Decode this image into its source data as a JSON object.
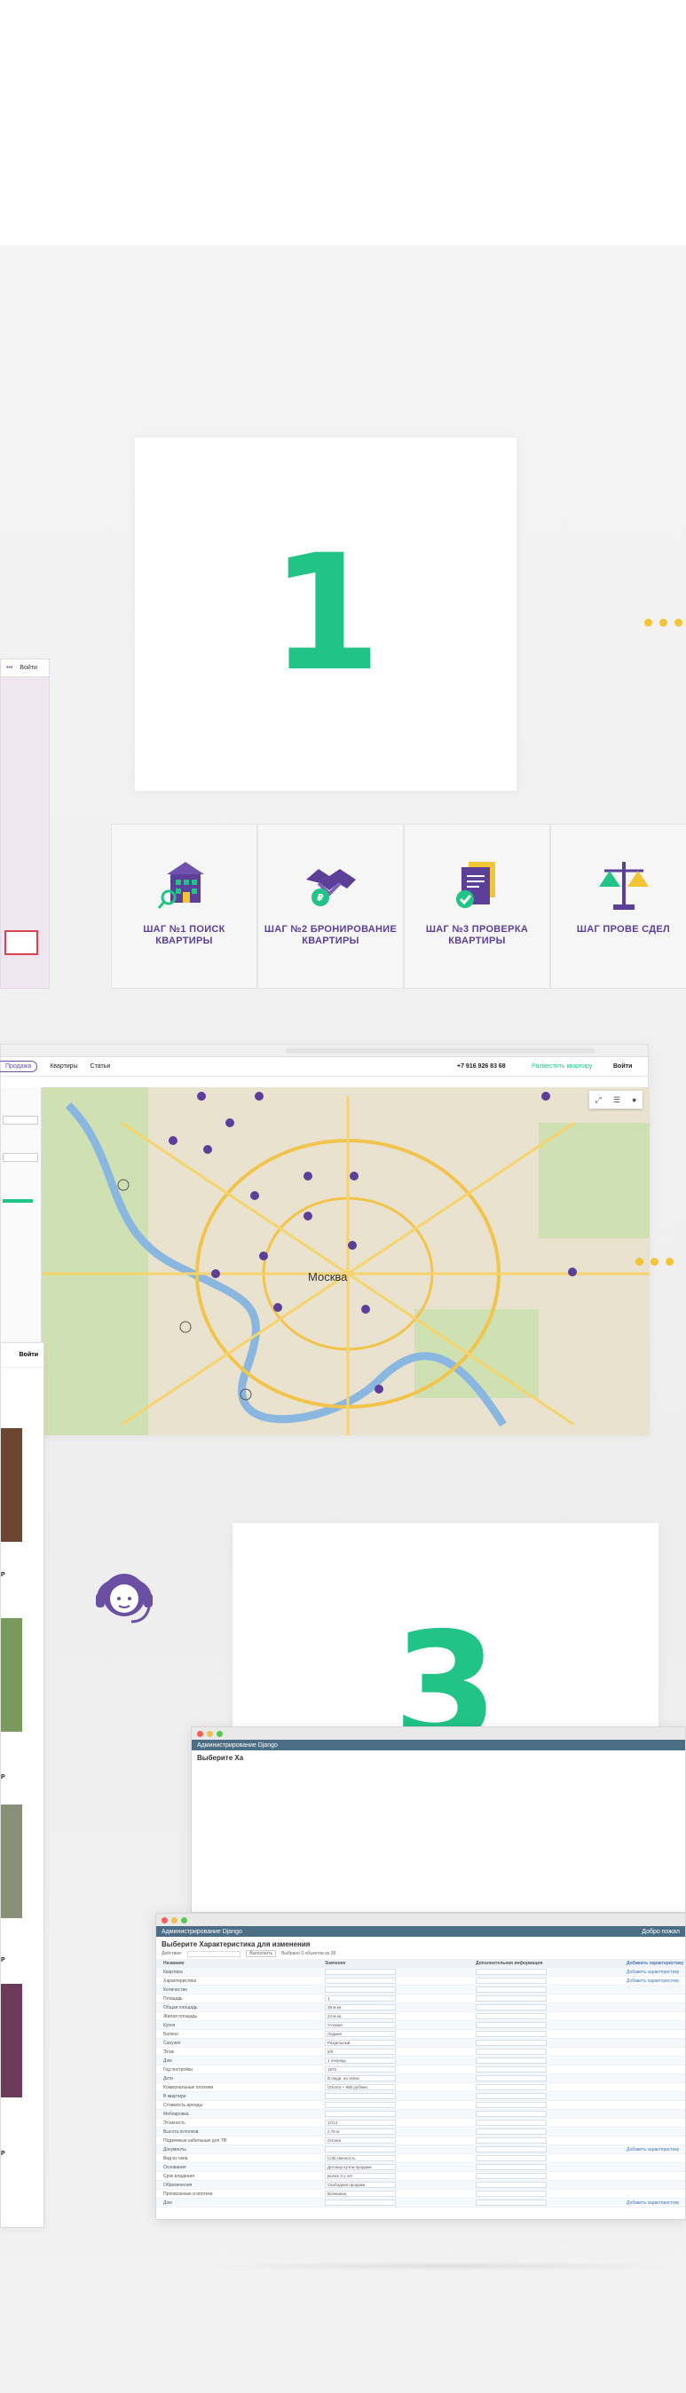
{
  "steps_section": {
    "card_number": "1",
    "steps": [
      {
        "label": "ШАГ №1 ПОИСК КВАРТИРЫ",
        "icon": "house-search-icon"
      },
      {
        "label": "ШАГ №2 БРОНИРОВАНИЕ КВАРТИРЫ",
        "icon": "handshake-ruble-icon"
      },
      {
        "label": "ШАГ №3 ПРОВЕРКА КВАРТИРЫ",
        "icon": "documents-check-icon"
      },
      {
        "label": "ШАГ ПРОВЕ СДЕЛ",
        "icon": "scales-icon"
      }
    ]
  },
  "pink_mock": {
    "nav_text": "Войти"
  },
  "map_window": {
    "nav_pill": "Продажа",
    "nav_items": [
      "Квартиры",
      "Статьи"
    ],
    "phone": "+7 916 926 83 68",
    "place_ad": "Разместить квартиру",
    "login": "Войти",
    "city_label": "Москва"
  },
  "phone_mock": {
    "login": "Войти",
    "price_marks": [
      "P",
      "P",
      "P",
      "P"
    ]
  },
  "support_section": {
    "card_number": "3",
    "icon": "support-headset-icon"
  },
  "admin_back": {
    "header": "Администрирование Django",
    "title": "Выберите Ха"
  },
  "admin_front": {
    "header": "Администрирование Django",
    "header_right": "Добро пожал",
    "title": "Выберите Характеристика для изменения",
    "action_label": "Действие:",
    "go_button": "Выполнить",
    "selected_text": "Выбрано 0 объектов из 38",
    "columns": [
      "Название",
      "Значение",
      "Дополнительная информация"
    ],
    "add_link": "Добавить характеристику",
    "rows": [
      {
        "name": "Квартира",
        "value": "",
        "link": "Добавить характеристику"
      },
      {
        "name": "Характеристика",
        "value": "",
        "link": "Добавить характеристику"
      },
      {
        "name": "Количество",
        "value": "",
        "link": ""
      },
      {
        "name": "Площадь",
        "value": "1",
        "link": ""
      },
      {
        "name": "Общая площадь",
        "value": "38 м.кв.",
        "link": ""
      },
      {
        "name": "Жилая площадь",
        "value": "24 м.кв.",
        "link": ""
      },
      {
        "name": "Кухня",
        "value": "Угловая",
        "link": ""
      },
      {
        "name": "Балкон",
        "value": "Лоджия",
        "link": ""
      },
      {
        "name": "Санузел",
        "value": "Раздельный",
        "link": ""
      },
      {
        "name": "Этаж",
        "value": "5/9",
        "link": ""
      },
      {
        "name": "Дом",
        "value": "1 очередь",
        "link": ""
      },
      {
        "name": "Год постройки",
        "value": "1975",
        "link": ""
      },
      {
        "name": "Дети",
        "value": "В люди, на связи",
        "link": ""
      },
      {
        "name": "Коммунальные платежи",
        "value": "Оплата + 990 руб/мес",
        "link": ""
      },
      {
        "name": "В квартире",
        "value": "",
        "link": ""
      },
      {
        "name": "Стоимость аренды",
        "value": "",
        "link": ""
      },
      {
        "name": "Меблировка",
        "value": "",
        "link": ""
      },
      {
        "name": "Этажность",
        "value": "17/14",
        "link": ""
      },
      {
        "name": "Высота потолков",
        "value": "2,75 м",
        "link": ""
      },
      {
        "name": "Подземные кабельные для ТВ",
        "value": "Оптика",
        "link": ""
      },
      {
        "name": "Документы",
        "value": "",
        "link": "Добавить характеристику"
      },
      {
        "name": "Вид из окна",
        "value": "Собственность",
        "link": ""
      },
      {
        "name": "Основания",
        "value": "Договор купли-продажи",
        "link": ""
      },
      {
        "name": "Срок владения",
        "value": "Более 3-х лет",
        "link": ""
      },
      {
        "name": "Обременения",
        "value": "Свободная продажа",
        "link": ""
      },
      {
        "name": "Прописанные в ипотеке",
        "value": "Возможна",
        "link": ""
      },
      {
        "name": "Дом",
        "value": "",
        "link": "Добавить характеристику"
      }
    ]
  },
  "colors": {
    "green": "#21c387",
    "purple": "#5b3f98",
    "yellow": "#f3c433",
    "red": "#d9444f"
  }
}
